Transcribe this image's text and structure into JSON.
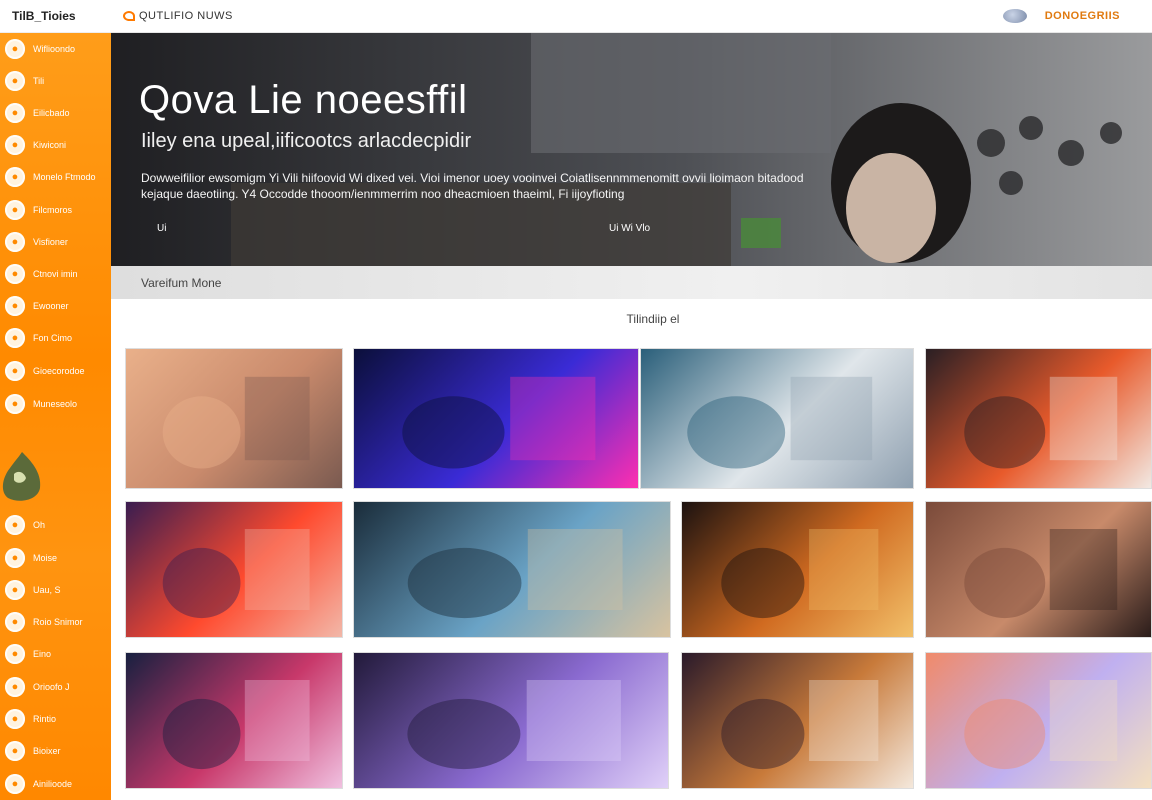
{
  "sidebar": {
    "brand": "TilB_Tioies",
    "items": [
      {
        "label": "Wiflioondo",
        "icon": "circle-icon"
      },
      {
        "label": "Tili",
        "icon": "circle-icon"
      },
      {
        "label": "Eilicbado",
        "icon": "circle-icon"
      },
      {
        "label": "Kiwiconi",
        "icon": "circle-icon"
      },
      {
        "label": "Monelo Ftmodo",
        "icon": "circle-icon"
      },
      {
        "label": "Filcmoros",
        "icon": "circle-icon"
      },
      {
        "label": "Visfioner",
        "icon": "circle-icon"
      },
      {
        "label": "Ctnovi imin",
        "icon": "circle-icon"
      },
      {
        "label": "Ewooner",
        "icon": "circle-icon"
      },
      {
        "label": "Fon Cimo",
        "icon": "circle-icon"
      },
      {
        "label": "Gioecorodoe",
        "icon": "circle-icon"
      },
      {
        "label": "Muneseolo",
        "icon": "circle-icon"
      },
      {
        "label": "Oh",
        "icon": "circle-icon"
      },
      {
        "label": "Moise",
        "icon": "circle-icon"
      },
      {
        "label": "Uau, S",
        "icon": "circle-icon"
      },
      {
        "label": "Roio Snimor",
        "icon": "circle-icon"
      },
      {
        "label": "Eino",
        "icon": "circle-icon"
      },
      {
        "label": "Orioofo J",
        "icon": "circle-icon"
      },
      {
        "label": "Rintio",
        "icon": "circle-icon"
      },
      {
        "label": "Bioixer",
        "icon": "circle-icon"
      },
      {
        "label": "Ainilioode",
        "icon": "circle-icon"
      }
    ]
  },
  "topbar": {
    "logo_text": "QUTLIFIO NUWS",
    "right_link": "DONOEGRIIS"
  },
  "hero": {
    "title": "Qova Lie noeesffil",
    "subtitle": "Iiley ena upeal,iificootcs arlacdecpidir",
    "description": "Dowweifilior ewsomigm Yi Vili hiifoovid Wi dixed vei. Vioi imenor uoey vooinvei Coiatlisennmmenomitt ovvii lioimaon bitadood kejaque daeotiing. Y4 Occodde thooom/ienmmerrim noo dheacmioen thaeiml, Fi iijoyfioting",
    "control_left": "Ui",
    "control_mid": "Ui  Wi Vlo"
  },
  "section": {
    "label": "Vareifum Mone"
  },
  "gallery": {
    "heading": "Tilindiip el",
    "tiles": [
      {
        "name": "sunset-sea-tile",
        "colors": [
          "#e9b08a",
          "#c98a6c",
          "#7a5a50"
        ]
      },
      {
        "name": "neon-city-tile",
        "colors": [
          "#0b0f3a",
          "#3a2bd6",
          "#ff2fb0"
        ]
      },
      {
        "name": "girl-hat-tile",
        "colors": [
          "#2a5f7a",
          "#e0e6ea",
          "#8fa0b0"
        ]
      },
      {
        "name": "billboard-tile",
        "colors": [
          "#2a1f24",
          "#e85a2b",
          "#f2e9e3"
        ]
      },
      {
        "name": "fire-woman-tile",
        "colors": [
          "#3a1d50",
          "#ff4a2e",
          "#f2b7a8"
        ]
      },
      {
        "name": "glitch-landscape-tile",
        "colors": [
          "#1a2c3a",
          "#6aa3c6",
          "#d8c3a0"
        ]
      },
      {
        "name": "night-market-tile",
        "colors": [
          "#1c1210",
          "#d06a20",
          "#f2c06a"
        ]
      },
      {
        "name": "street-scene-tile",
        "colors": [
          "#7a4a3a",
          "#c88a6a",
          "#2a1c1a"
        ]
      },
      {
        "name": "city-night-tile",
        "colors": [
          "#182040",
          "#c8386a",
          "#f0c0e0"
        ]
      },
      {
        "name": "purple-concert-tile",
        "colors": [
          "#221a3a",
          "#8a6ad0",
          "#e0d0f8"
        ]
      },
      {
        "name": "collage-tile",
        "colors": [
          "#2a1a2a",
          "#c87a3a",
          "#f4e8dc"
        ]
      },
      {
        "name": "festival-tile",
        "colors": [
          "#f08a6a",
          "#c0b0f0",
          "#f4e0c0"
        ]
      },
      {
        "name": "crowd-tile",
        "colors": [
          "#2a2a2a",
          "#8a6a4a",
          "#d8d0c8"
        ]
      }
    ]
  },
  "colors": {
    "accent": "#ff8a00",
    "brand_text": "#e07a10"
  }
}
